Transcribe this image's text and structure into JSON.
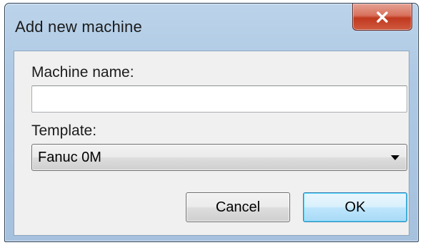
{
  "dialog": {
    "title": "Add new machine",
    "close_icon": "close-icon"
  },
  "form": {
    "machine_name_label": "Machine name:",
    "machine_name_value": "",
    "machine_name_placeholder": "",
    "template_label": "Template:",
    "template_selected": "Fanuc 0M",
    "template_dropdown_icon": "chevron-down-icon"
  },
  "buttons": {
    "cancel_label": "Cancel",
    "ok_label": "OK"
  },
  "colors": {
    "close_button": "#c0391f",
    "ok_button_border": "#3c7fb1"
  }
}
